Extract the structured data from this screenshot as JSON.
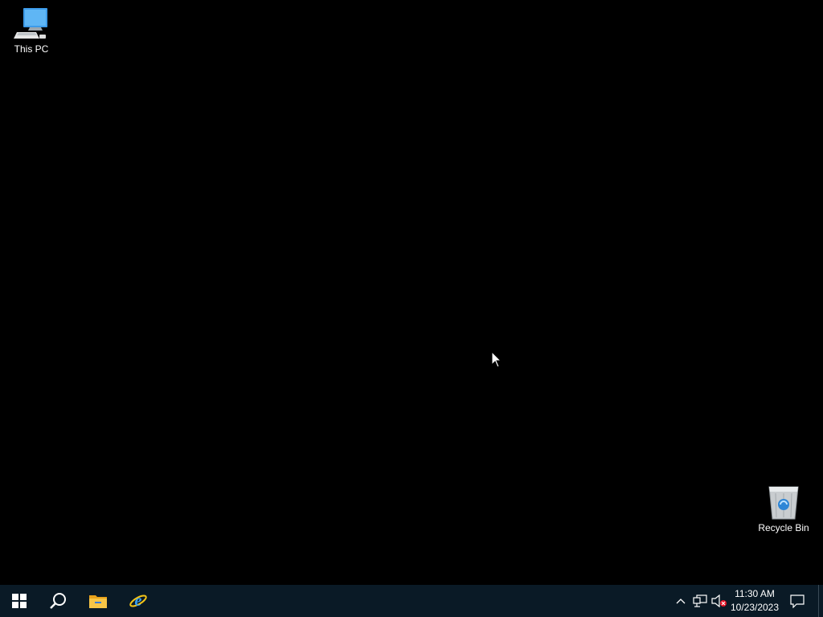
{
  "desktop": {
    "background_color": "#000000",
    "icons": [
      {
        "label": "This PC",
        "icon": "this-pc-icon"
      },
      {
        "label": "Recycle Bin",
        "icon": "recycle-bin-icon"
      }
    ]
  },
  "taskbar": {
    "background_color": "#0a1a26",
    "buttons": [
      {
        "icon": "windows-start-icon"
      },
      {
        "icon": "search-icon"
      },
      {
        "icon": "file-explorer-icon"
      },
      {
        "icon": "internet-explorer-icon"
      }
    ],
    "tray": {
      "icons": [
        "show-hidden-icons-chevron-icon",
        "network-icon",
        "volume-muted-icon"
      ],
      "time": "11:30 AM",
      "date": "10/23/2023",
      "action_center_icon": "notification-icon"
    }
  }
}
